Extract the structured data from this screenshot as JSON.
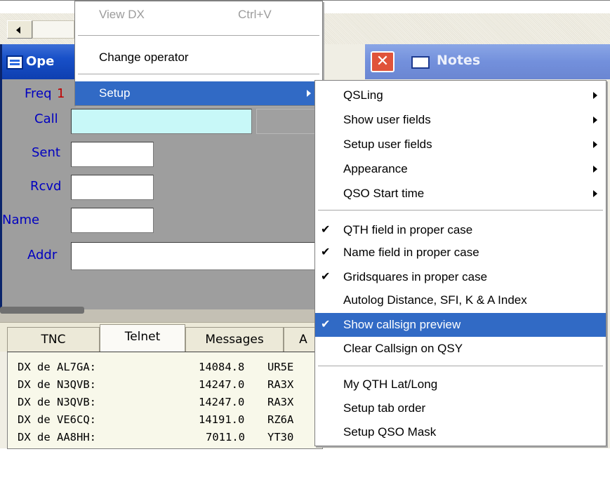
{
  "operator_window": {
    "title": "Ope",
    "labels": {
      "freq": "Freq",
      "freq_value": "1",
      "call": "Call",
      "sent": "Sent",
      "rcvd": "Rcvd",
      "name": "Name",
      "addr": "Addr"
    }
  },
  "notes_window": {
    "close_glyph": "✕",
    "title": "Notes"
  },
  "telnet": {
    "tabs": [
      "TNC",
      "Telnet",
      "Messages",
      "A"
    ],
    "active_tab": "Telnet",
    "rows": [
      {
        "de": "DX de AL7GA:",
        "freq": "14084.8",
        "call": "UR5E"
      },
      {
        "de": "DX de N3QVB:",
        "freq": "14247.0",
        "call": "RA3X"
      },
      {
        "de": "DX de N3QVB:",
        "freq": "14247.0",
        "call": "RA3X"
      },
      {
        "de": "DX de VE6CQ:",
        "freq": "14191.0",
        "call": "RZ6A"
      },
      {
        "de": "DX de AA8HH:",
        "freq": "7011.0",
        "call": "YT30"
      }
    ]
  },
  "main_menu": {
    "items": [
      {
        "label": "View DX",
        "shortcut": "Ctrl+V",
        "disabled": true
      },
      {
        "label": "Change operator"
      },
      {
        "label": "Setup",
        "highlighted": true,
        "submenu": true
      }
    ]
  },
  "setup_menu": {
    "items": [
      {
        "label": "QSLing",
        "submenu": true
      },
      {
        "label": "Show user fields",
        "submenu": true
      },
      {
        "label": "Setup user fields",
        "submenu": true
      },
      {
        "label": "Appearance",
        "submenu": true
      },
      {
        "label": "QSO Start time",
        "submenu": true
      },
      {
        "label": "QTH field in proper case",
        "checked": true
      },
      {
        "label": "Name field in proper case",
        "checked": true
      },
      {
        "label": "Gridsquares in proper case",
        "checked": true
      },
      {
        "label": "Autolog Distance, SFI, K & A Index"
      },
      {
        "label": "Show callsign preview",
        "checked": true,
        "highlighted": true
      },
      {
        "label": "Clear Callsign on QSY"
      },
      {
        "label": "My QTH Lat/Long"
      },
      {
        "label": "Setup tab order"
      },
      {
        "label": "Setup QSO Mask"
      }
    ],
    "check_glyph": "✔"
  },
  "colors": {
    "menu_highlight": "#316ac5",
    "title_active": "#1850c8",
    "label_blue": "#0000c0",
    "call_field": "#c8f8f8"
  }
}
